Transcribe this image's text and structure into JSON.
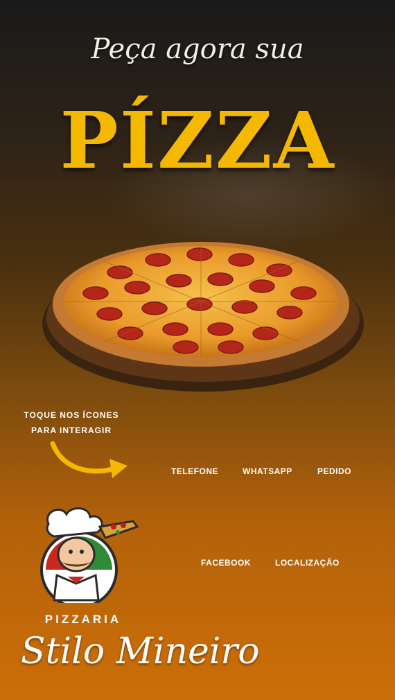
{
  "header": {
    "line1": "Peça agora sua",
    "line2": "PÍZZA"
  },
  "instruction": {
    "line1": "TOQUE NOS ÍCONES",
    "line2": "PARA INTERAGIR"
  },
  "actions": {
    "row1": [
      "TELEFONE",
      "WHATSAPP",
      "PEDIDO"
    ],
    "row2": [
      "FACEBOOK",
      "LOCALIZAÇÃO"
    ]
  },
  "brand": {
    "label": "PIZZARIA",
    "name": "Stilo Mineiro"
  },
  "colors": {
    "accent": "#f5b800",
    "text": "#ffffff",
    "bg_top": "#1a1a1a",
    "bg_bottom": "#cc6e08"
  },
  "icons": [
    "pizza-image",
    "arrow-icon",
    "chef-logo"
  ]
}
